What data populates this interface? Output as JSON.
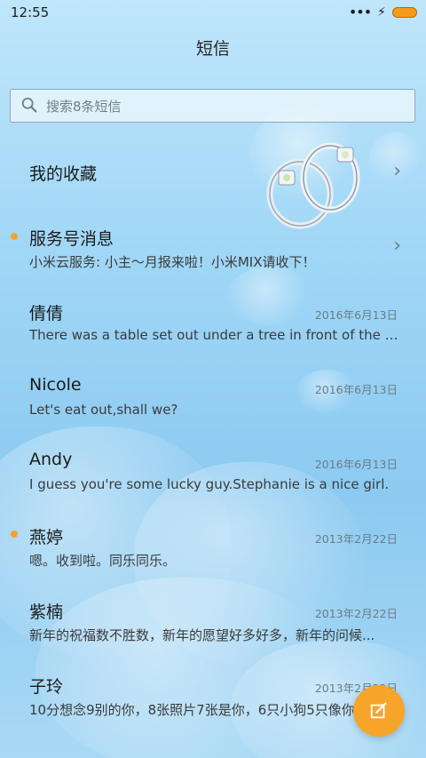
{
  "status_bar": {
    "time": "12:55",
    "more": "•••",
    "charging": "⚡"
  },
  "header": {
    "title": "短信"
  },
  "search": {
    "placeholder": "搜索8条短信"
  },
  "conversations": [
    {
      "name": "我的收藏",
      "preview": "",
      "date": "",
      "unread": false,
      "chevron": true
    },
    {
      "name": "服务号消息",
      "preview": "小米云服务: 小主～月报来啦！小米MIX请收下！",
      "date": "",
      "unread": true,
      "chevron": true
    },
    {
      "name": "倩倩",
      "preview": "There was a table set out under a tree in front of the ho...",
      "date": "2016年6月13日",
      "unread": false,
      "chevron": false
    },
    {
      "name": "Nicole",
      "preview": "Let's eat out,shall we?",
      "date": "2016年6月13日",
      "unread": false,
      "chevron": false
    },
    {
      "name": "Andy",
      "preview": "I guess you're some lucky guy.Stephanie is a nice girl.",
      "date": "2016年6月13日",
      "unread": false,
      "chevron": false
    },
    {
      "name": "燕婷",
      "preview": "嗯。收到啦。同乐同乐。",
      "date": "2013年2月22日",
      "unread": true,
      "chevron": false
    },
    {
      "name": "紫楠",
      "preview": "新年的祝福数不胜数，新年的愿望好多好多，新年的问候...",
      "date": "2013年2月22日",
      "unread": false,
      "chevron": false
    },
    {
      "name": "子玲",
      "preview": "10分想念9别的你，8张照片7张是你，6只小狗5只像你",
      "date": "2013年2月22日",
      "unread": false,
      "chevron": false
    }
  ],
  "colors": {
    "accent": "#f7a52a",
    "unread_dot": "#f8a12a"
  },
  "icons": {
    "search": "search-icon",
    "compose": "compose-icon",
    "chevron": "chevron-right-icon"
  }
}
